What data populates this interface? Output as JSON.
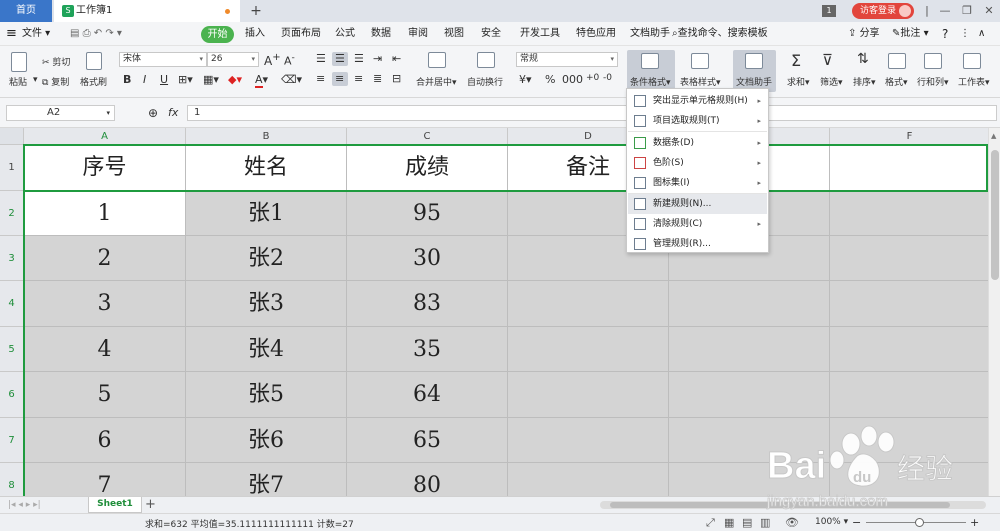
{
  "tabs": {
    "home": "首页",
    "book": "工作簿1",
    "new_tab": "+"
  },
  "titlebar": {
    "window_count": "1",
    "login": "访客登录",
    "min": "—",
    "restore": "❐",
    "close": "✕",
    "help": "?"
  },
  "menubar": {
    "file": "文件",
    "items": [
      "开始",
      "插入",
      "页面布局",
      "公式",
      "数据",
      "审阅",
      "视图",
      "安全",
      "开发工具",
      "特色应用",
      "文档助手"
    ],
    "search": "查找命令、搜索模板",
    "share": "分享",
    "comment": "批注"
  },
  "ribbon": {
    "paste": "粘贴",
    "cut": "剪切",
    "copy": "复制",
    "format_painter": "格式刷",
    "font_name": "宋体",
    "font_size": "26",
    "merge_center": "合并居中",
    "wrap_text": "自动换行",
    "number_format": "常规",
    "conditional_format": "条件格式",
    "table_style": "表格样式",
    "doc_assistant": "文档助手",
    "sum": "求和",
    "filter": "筛选",
    "sort": "排序",
    "format": "格式",
    "row_col": "行和列",
    "worksheet": "工作表"
  },
  "formula_bar": {
    "cell_ref": "A2",
    "fx": "fx",
    "value": "1"
  },
  "columns": [
    "A",
    "B",
    "C",
    "D",
    "E",
    "F"
  ],
  "rows": [
    "1",
    "2",
    "3",
    "4",
    "5",
    "6",
    "7",
    "8"
  ],
  "table": {
    "headers": [
      "序号",
      "姓名",
      "成绩",
      "备注"
    ],
    "data": [
      [
        "1",
        "张1",
        "95"
      ],
      [
        "2",
        "张2",
        "30"
      ],
      [
        "3",
        "张3",
        "83"
      ],
      [
        "4",
        "张4",
        "35"
      ],
      [
        "5",
        "张5",
        "64"
      ],
      [
        "6",
        "张6",
        "65"
      ],
      [
        "7",
        "张7",
        "80"
      ]
    ]
  },
  "cf_menu": [
    {
      "label": "突出显示单元格规则(H)",
      "sub": true
    },
    {
      "label": "项目选取规则(T)",
      "sub": true
    },
    {
      "label": "数据条(D)",
      "sub": true
    },
    {
      "label": "色阶(S)",
      "sub": true
    },
    {
      "label": "图标集(I)",
      "sub": true
    },
    {
      "label": "新建规则(N)...",
      "sub": false
    },
    {
      "label": "清除规则(C)",
      "sub": true
    },
    {
      "label": "管理规则(R)...",
      "sub": false
    }
  ],
  "sheet": {
    "name": "Sheet1"
  },
  "status": {
    "summary": "求和=632   平均值=35.1111111111111   计数=27",
    "zoom": "100%"
  },
  "watermark": {
    "brand": "Bai",
    "du": "du",
    "jy": "经验",
    "url": "jingyan.baidu.com"
  },
  "colors": {
    "accent": "#4bb34f",
    "selection_border": "#1f9b3f",
    "home_tab": "#3a76c9",
    "login": "#e2453c"
  }
}
